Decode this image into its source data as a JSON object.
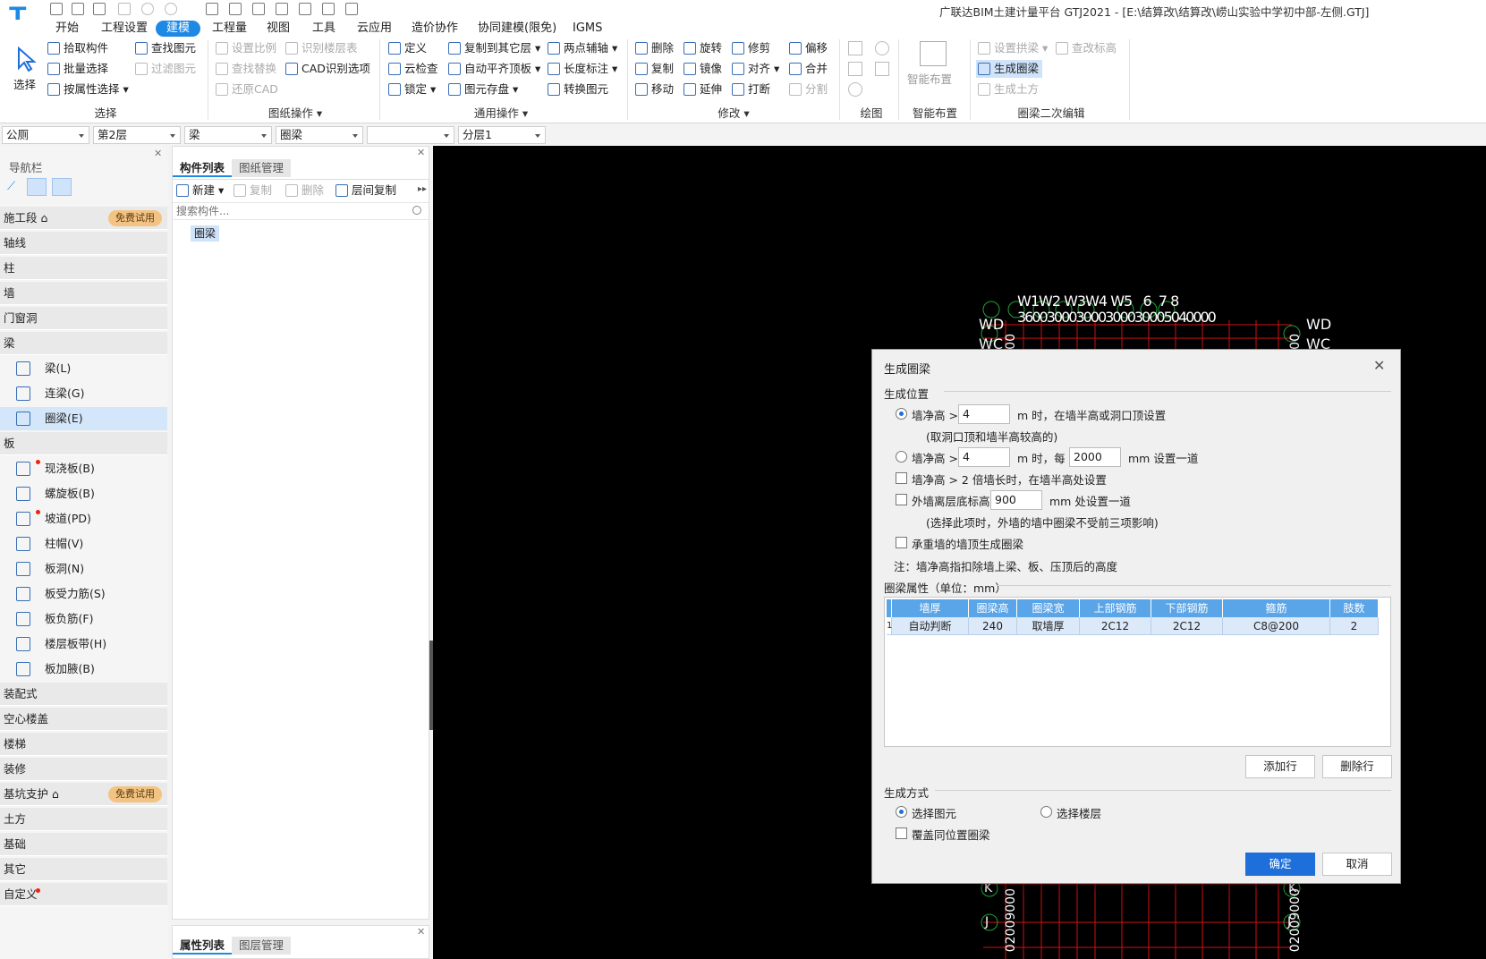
{
  "app": {
    "title": "广联达BIM土建计量平台 GTJ2021 - [E:\\结算改\\结算改\\崂山实验中学初中部-左侧.GTJ]"
  },
  "menu": [
    "开始",
    "工程设置",
    "建模",
    "工程量",
    "视图",
    "工具",
    "云应用",
    "造价协作",
    "协同建模(限免)",
    "IGMS"
  ],
  "ribbon": {
    "select": {
      "big": "选择",
      "items": [
        "拾取构件",
        "批量选择",
        "按属性选择"
      ],
      "group": "选择"
    },
    "find": {
      "items": [
        "查找图元",
        "过滤图元"
      ]
    },
    "drawing": {
      "items": [
        "设置比例",
        "识别楼层表",
        "查找替换",
        "CAD识别选项",
        "还原CAD"
      ],
      "group": "图纸操作"
    },
    "general": {
      "items": [
        "定义",
        "复制到其它层",
        "两点辅轴",
        "云检查",
        "自动平齐顶板",
        "长度标注",
        "锁定",
        "图元存盘",
        "转换图元"
      ],
      "group": "通用操作"
    },
    "modify": {
      "items": [
        "删除",
        "旋转",
        "修剪",
        "偏移",
        "复制",
        "镜像",
        "对齐",
        "合并",
        "移动",
        "延伸",
        "打断",
        "分割"
      ],
      "group": "修改"
    },
    "draw": {
      "group": "绘图"
    },
    "smart": {
      "big": "智能布置",
      "group": "智能布置"
    },
    "ringbeam": {
      "items": [
        "设置拱梁",
        "查改标高",
        "生成圈梁",
        "生成土方"
      ],
      "group": "圈梁二次编辑"
    }
  },
  "filters": [
    "公厕",
    "第2层",
    "梁",
    "圈梁",
    "",
    "分层1"
  ],
  "nav": {
    "title": "导航栏",
    "trial": "免费试用",
    "categories": [
      "施工段",
      "轴线",
      "柱",
      "墙",
      "门窗洞",
      "梁",
      "板",
      "装配式",
      "空心楼盖",
      "楼梯",
      "装修",
      "基坑支护",
      "土方",
      "基础",
      "其它",
      "自定义"
    ],
    "beam_items": [
      "梁(L)",
      "连梁(G)",
      "圈梁(E)"
    ],
    "slab_items": [
      "现浇板(B)",
      "螺旋板(B)",
      "坡道(PD)",
      "柱帽(V)",
      "板洞(N)",
      "板受力筋(S)",
      "板负筋(F)",
      "楼层板带(H)",
      "板加腋(B)"
    ]
  },
  "component": {
    "tabs": [
      "构件列表",
      "图纸管理"
    ],
    "toolbar": [
      "新建",
      "复制",
      "删除",
      "层间复制"
    ],
    "search_placeholder": "搜索构件...",
    "items": [
      "圈梁"
    ],
    "bottom_tabs": [
      "属性列表",
      "图层管理"
    ]
  },
  "canvas": {
    "top_labels": [
      "W1",
      "W2",
      "W3",
      "W4",
      "W5",
      "6",
      "7",
      "8"
    ],
    "top_dims": "360030003000300030005040000",
    "left_label": "WD",
    "right_label": "WD",
    "left_label2": "WC",
    "right_label2": "WC",
    "axis_k": "K",
    "axis_j": "J",
    "side_dim": "3000",
    "side_dim2": "02009000"
  },
  "dialog": {
    "title": "生成圈梁",
    "sec_position": "生成位置",
    "r1_label": "墙净高 >",
    "r1_value": "4",
    "r1_suffix": "m 时，在墙半高或洞口顶设置",
    "r1_note": "(取洞口顶和墙半高较高的)",
    "r2_label": "墙净高 >",
    "r2_value": "4",
    "r2_mid": "m 时，每",
    "r2_value2": "2000",
    "r2_suffix": "mm 设置一道",
    "c1_label": "墙净高 > 2 倍墙长时，在墙半高处设置",
    "c2_label": "外墙离层底标高",
    "c2_value": "900",
    "c2_suffix": "mm 处设置一道",
    "c2_note": "(选择此项时，外墙的墙中圈梁不受前三项影响)",
    "c3_label": "承重墙的墙顶生成圈梁",
    "note": "注：墙净高指扣除墙上梁、板、压顶后的高度",
    "sec_props": "圈梁属性（单位：mm）",
    "columns": [
      "墙厚",
      "圈梁高",
      "圈梁宽",
      "上部钢筋",
      "下部钢筋",
      "箍筋",
      "肢数"
    ],
    "rows": [
      [
        "1",
        "自动判断",
        "240",
        "取墙厚",
        "2C12",
        "2C12",
        "C8@200",
        "2"
      ]
    ],
    "add_row": "添加行",
    "del_row": "删除行",
    "sec_method": "生成方式",
    "m1": "选择图元",
    "m2": "选择楼层",
    "m3": "覆盖同位置圈梁",
    "ok": "确定",
    "cancel": "取消"
  }
}
